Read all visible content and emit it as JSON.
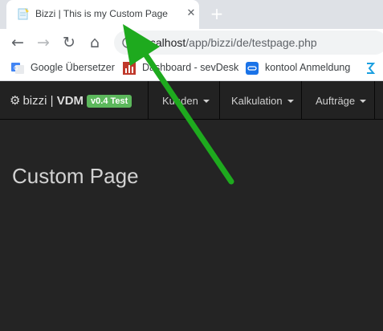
{
  "browser": {
    "tab": {
      "title": "Bizzi | This is my Custom Page",
      "close_glyph": "✕",
      "favicon_icon": "notepad-icon"
    },
    "new_tab_glyph": "+",
    "toolbar": {
      "back_glyph": "←",
      "forward_glyph": "→",
      "reload_glyph": "↻",
      "home_glyph": "⌂"
    },
    "url": {
      "host": "localhost",
      "path": "/app/bizzi/de/testpage.php"
    },
    "bookmarks": [
      {
        "label": "Google Übersetzer",
        "icon": "google-translate-icon"
      },
      {
        "label": "Dashboard - sevDesk",
        "icon": "bar-chart-icon"
      },
      {
        "label": "kontool Anmeldung",
        "icon": "kontool-icon"
      }
    ]
  },
  "app": {
    "brand": {
      "name": "bizzi",
      "separator": " | ",
      "product": "VDM",
      "version_badge": "v0.4 Test"
    },
    "nav": [
      {
        "label": "Kunden"
      },
      {
        "label": "Kalkulation"
      },
      {
        "label": "Aufträge"
      }
    ]
  },
  "content": {
    "title": "Custom Page"
  },
  "colors": {
    "navbar_bg": "#222222",
    "content_bg": "#242424",
    "badge_green": "#5cb85c",
    "annotation_arrow": "#1eaa1e"
  }
}
